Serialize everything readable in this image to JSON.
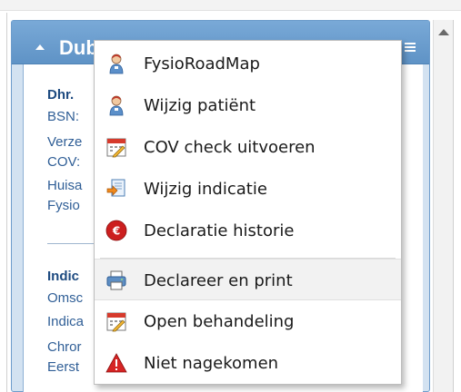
{
  "header": {
    "title": "Dubbeloa W"
  },
  "patient": {
    "name_line": "Dhr.",
    "fields": [
      "BSN:",
      "Verze",
      "COV:",
      "Huisa",
      "Fysio"
    ]
  },
  "indication": {
    "heading": "Indic",
    "fields": [
      "Omsc",
      "Indica",
      "Chror",
      "Eerst"
    ]
  },
  "menu": {
    "items": [
      {
        "label": "FysioRoadMap",
        "icon": "person-icon"
      },
      {
        "label": "Wijzig patiënt",
        "icon": "person-icon"
      },
      {
        "label": "COV check uitvoeren",
        "icon": "calendar-edit-icon"
      },
      {
        "label": "Wijzig indicatie",
        "icon": "document-edit-icon"
      },
      {
        "label": "Declaratie historie",
        "icon": "euro-icon"
      },
      {
        "label": "Declareer en print",
        "icon": "printer-icon"
      },
      {
        "label": "Open behandeling",
        "icon": "calendar-edit-icon"
      },
      {
        "label": "Niet nagekomen",
        "icon": "warning-icon"
      }
    ]
  },
  "colors": {
    "header_blue": "#6a9dcf",
    "panel_blue": "#d3e2f1",
    "text_blue": "#2f5e96",
    "hover_gray": "#f2f2f2",
    "warning_red": "#d62424",
    "euro_red": "#cc1f1f"
  }
}
